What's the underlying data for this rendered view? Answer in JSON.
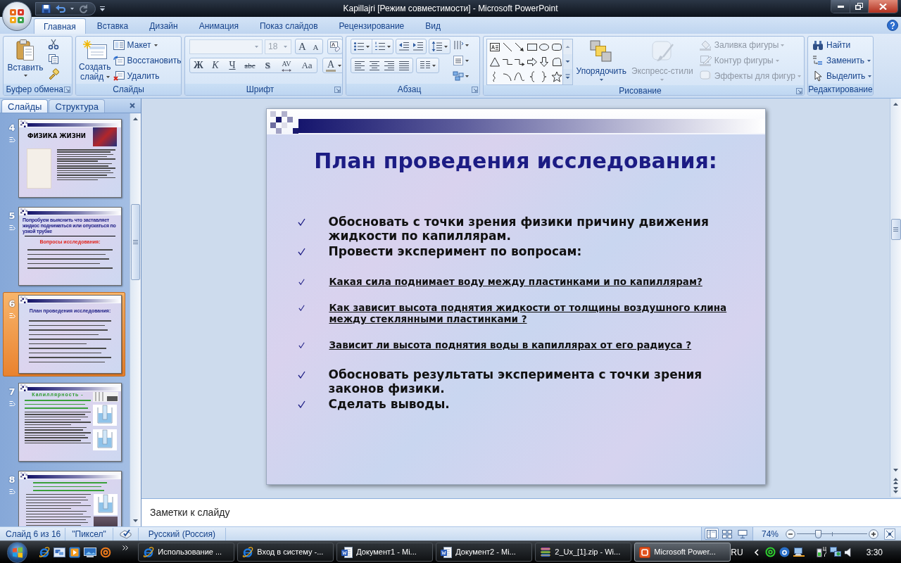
{
  "window": {
    "title": "Kapillajri [Режим совместимости] - Microsoft PowerPoint"
  },
  "ribbon": {
    "tabs": [
      {
        "label": "Главная",
        "selected": true
      },
      {
        "label": "Вставка",
        "selected": false
      },
      {
        "label": "Дизайн",
        "selected": false
      },
      {
        "label": "Анимация",
        "selected": false
      },
      {
        "label": "Показ слайдов",
        "selected": false
      },
      {
        "label": "Рецензирование",
        "selected": false
      },
      {
        "label": "Вид",
        "selected": false
      }
    ],
    "clipboard": {
      "label": "Буфер обмена",
      "paste": "Вставить"
    },
    "slides": {
      "label": "Слайды",
      "new_slide": "Создать слайд",
      "buttons": [
        {
          "label": "Макет",
          "dropdown": true
        },
        {
          "label": "Восстановить",
          "dropdown": false
        },
        {
          "label": "Удалить",
          "dropdown": false
        }
      ]
    },
    "font": {
      "label": "Шрифт",
      "font_field": {
        "disabled": true
      },
      "size_field": {
        "value": "18",
        "disabled": true
      },
      "size_buttons": [
        {
          "label": "A",
          "kind": "grow"
        },
        {
          "label": "A",
          "kind": "shrink"
        }
      ],
      "style_buttons": [
        {
          "label": "Ж",
          "kind": "bold"
        },
        {
          "label": "К",
          "kind": "italic"
        },
        {
          "label": "Ч",
          "kind": "underline"
        },
        {
          "label": "abc",
          "kind": "strike"
        },
        {
          "label": "S",
          "kind": "shadow"
        },
        {
          "label": "AV",
          "kind": "spacing"
        },
        {
          "label": "Aa",
          "kind": "case"
        }
      ],
      "color_button": {
        "label": "A"
      }
    },
    "paragraph": {
      "label": "Абзац"
    },
    "drawing": {
      "label": "Рисование",
      "buttons": [
        {
          "label": "Упорядочить",
          "kind": "large",
          "disabled": false
        },
        {
          "label": "Экспресс-стили",
          "kind": "large",
          "disabled": true
        },
        {
          "label": "Заливка фигуры",
          "kind": "small",
          "disabled": true
        },
        {
          "label": "Контур фигуры",
          "kind": "small",
          "disabled": true
        },
        {
          "label": "Эффекты для фигур",
          "kind": "small",
          "disabled": true
        }
      ]
    },
    "editing": {
      "label": "Редактирование",
      "buttons": [
        {
          "label": "Найти",
          "dropdown": false
        },
        {
          "label": "Заменить",
          "dropdown": true
        },
        {
          "label": "Выделить",
          "dropdown": true
        }
      ]
    }
  },
  "slides_pane": {
    "tabs": [
      {
        "label": "Слайды",
        "selected": true
      },
      {
        "label": "Структура",
        "selected": false
      }
    ],
    "thumbnails": [
      {
        "number": "4",
        "selected": false,
        "kind": "pictures",
        "title": "ФИЗИКА ЖИЗНИ"
      },
      {
        "number": "5",
        "selected": false,
        "kind": "questions",
        "title": "Попробуем выяснить что заставляет жидкос подниматься или опускаться по узкой трубке",
        "subtitle": "Вопросы исследования:"
      },
      {
        "number": "6",
        "selected": true,
        "kind": "plan",
        "title": "План проведения исследования:"
      },
      {
        "number": "7",
        "selected": false,
        "kind": "diagram",
        "title": "Капиллярность -"
      },
      {
        "number": "8",
        "selected": false,
        "kind": "formula"
      }
    ]
  },
  "slide": {
    "title": "План проведения исследования:",
    "items": [
      {
        "kind": "main",
        "text": "Обосновать с точки зрения физики причину движения жидкости по капиллярам."
      },
      {
        "kind": "main",
        "text": "Провести эксперимент по вопросам:"
      },
      {
        "kind": "sub",
        "text": "Какая сила поднимает воду между пластинками и по капиллярам?"
      },
      {
        "kind": "sub",
        "text": "Как зависит высота поднятия жидкости от толщины воздушного клина между стеклянными пластинками ?"
      },
      {
        "kind": "sub",
        "text": "Зависит ли высота поднятия воды в капиллярах от его радиуса ?"
      },
      {
        "kind": "main",
        "text": "Обосновать результаты эксперимента с точки зрения законов физики."
      },
      {
        "kind": "main",
        "text": "Сделать выводы."
      }
    ]
  },
  "notes": {
    "placeholder": "Заметки к слайду"
  },
  "status_bar": {
    "slide_info": "Слайд 6 из 16",
    "theme": "\"Пиксел\"",
    "language": "Русский (Россия)",
    "view_buttons": [
      {
        "kind": "normal",
        "selected": true
      },
      {
        "kind": "sorter",
        "selected": false
      },
      {
        "kind": "show",
        "selected": false
      }
    ],
    "zoom": "74%",
    "zoom_slider": {
      "level": 0.3
    }
  },
  "taskbar": {
    "tasks": [
      {
        "label": "Использование ...",
        "kind": "browser",
        "selected": false
      },
      {
        "label": "Вход в систему -...",
        "kind": "browser",
        "selected": false
      },
      {
        "label": "Документ1 - Mi...",
        "kind": "document",
        "selected": false
      },
      {
        "label": "Документ2 - Mi...",
        "kind": "document",
        "selected": false
      },
      {
        "label": "2_Ux_[1].zip - Wi...",
        "kind": "archive",
        "selected": false
      },
      {
        "label": "Microsoft Power...",
        "kind": "presentation",
        "selected": true
      }
    ],
    "tray": {
      "language": "RU",
      "time": "3:30"
    }
  }
}
